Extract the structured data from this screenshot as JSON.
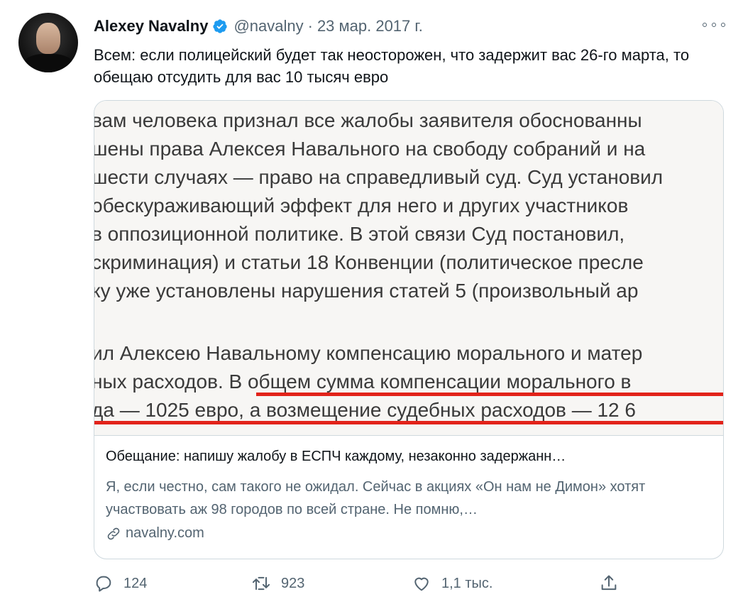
{
  "tweet": {
    "author_name": "Alexey Navalny",
    "handle": "@navalny",
    "separator": "·",
    "date": "23 мар. 2017 г.",
    "text": "Всем: если полицейский будет так неосторожен, что задержит вас 26-го марта, то обещаю отсудить для вас 10 тысяч евро"
  },
  "card": {
    "image_lines": [
      "вам человека признал все жалобы заявителя обоснованны",
      "шены права Алексея Навального на свободу собраний и на",
      "шести случаях — право на справедливый суд. Суд установил",
      "обескураживающий эффект для него и других участников",
      "в оппозиционной политике. В этой связи Суд постановил,",
      "скриминация) и статьи 18 Конвенции (политическое пресле",
      "ку уже установлены нарушения статей 5 (произвольный ар",
      "ил Алексею Навальному компенсацию морального и матер",
      "ных расходов. В общем сумма компенсации морального в",
      "да — 1025 евро, а возмещение судебных расходов — 12 6"
    ],
    "title": "Обещание: напишу жалобу в ЕСПЧ каждому, незаконно задержанн…",
    "description": "Я, если честно, сам такого не ожидал. Сейчас в акциях «Он нам не Димон» хотят участвовать аж 98 городов по всей стране. Не помню,…",
    "domain": "navalny.com"
  },
  "actions": {
    "reply_count": "124",
    "retweet_count": "923",
    "like_count": "1,1 тыс."
  },
  "icons": {
    "verified": "verified-badge-icon",
    "more": "more-options-icon",
    "link": "link-icon",
    "reply": "reply-icon",
    "retweet": "retweet-icon",
    "like": "like-icon",
    "share": "share-icon"
  },
  "colors": {
    "accent": "#1d9bf0",
    "secondary_text": "#536471",
    "underline_red": "#e2231a"
  }
}
